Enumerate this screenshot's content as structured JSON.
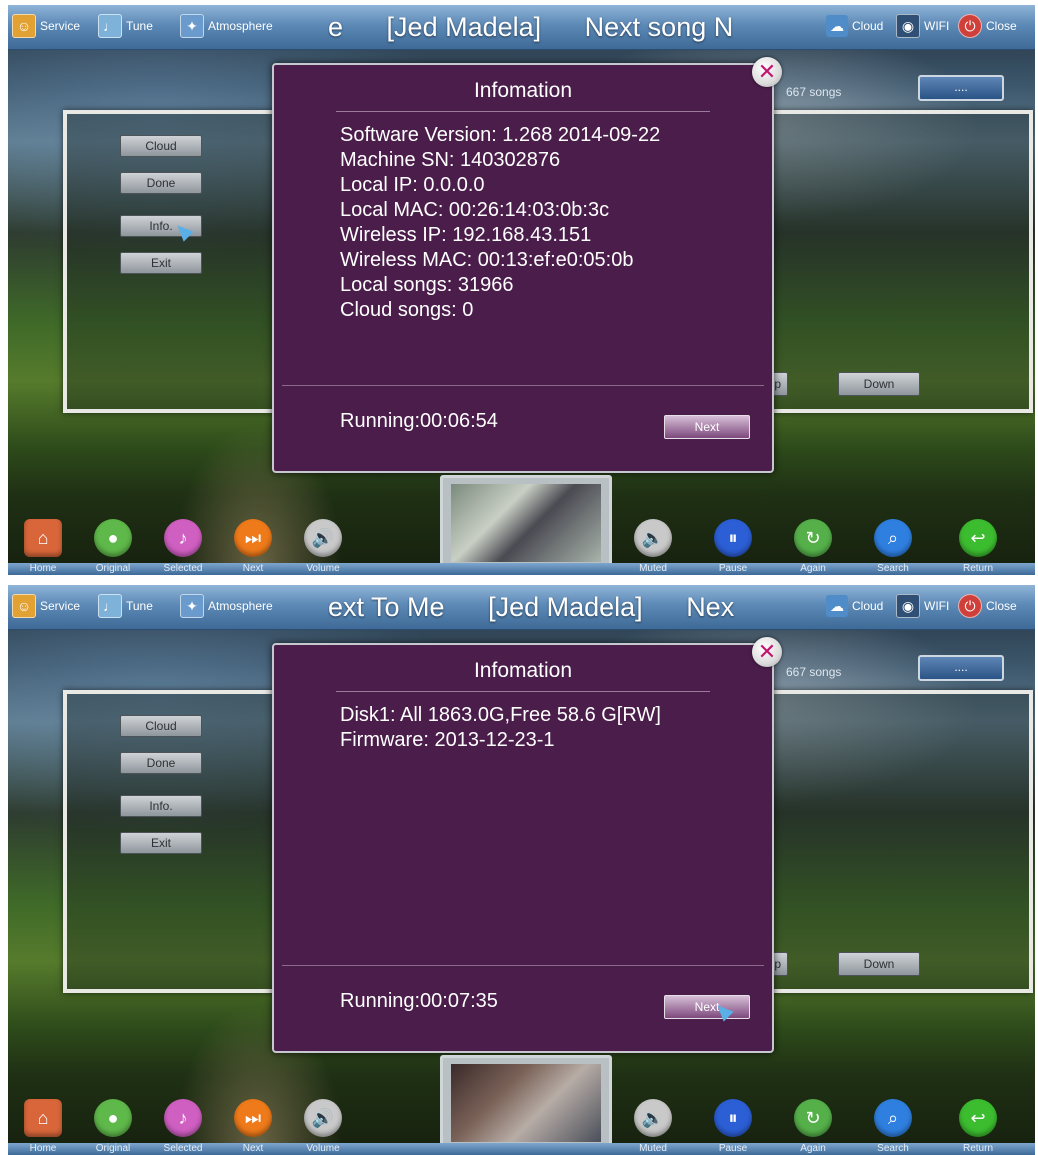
{
  "colors": {
    "dialog_bg": "#4a1d4a",
    "close_accent": "#c0166e",
    "topbar": "#5c89b6"
  },
  "topbar": {
    "left_items": [
      {
        "label": "Service",
        "icon": "service-icon"
      },
      {
        "label": "Tune",
        "icon": "tune-icon"
      },
      {
        "label": "Atmosphere",
        "icon": "atmosphere-icon"
      }
    ],
    "right_items": [
      {
        "label": "Cloud",
        "icon": "cloud-icon"
      },
      {
        "label": "WIFI",
        "icon": "wifi-icon"
      },
      {
        "label": "Close",
        "icon": "power-icon"
      }
    ]
  },
  "left_menu": [
    "Cloud",
    "Done",
    "Info.",
    "Exit"
  ],
  "list_nav": {
    "up": "p",
    "down": "Down"
  },
  "song_count": "667 songs",
  "more_button": "....",
  "bottom_bar": [
    {
      "label": "Home",
      "icon": "home-icon"
    },
    {
      "label": "Original",
      "icon": "original-icon"
    },
    {
      "label": "Selected",
      "icon": "selected-icon"
    },
    {
      "label": "Next",
      "icon": "next-icon"
    },
    {
      "label": "Volume",
      "icon": "volume-icon"
    },
    {
      "label": "Muted",
      "icon": "muted-icon"
    },
    {
      "label": "Pause",
      "icon": "pause-icon"
    },
    {
      "label": "Again",
      "icon": "again-icon"
    },
    {
      "label": "Search",
      "icon": "search-icon"
    },
    {
      "label": "Return",
      "icon": "return-icon"
    }
  ],
  "screens": [
    {
      "ticker": [
        "e",
        "[Jed Madela]",
        "Next song N"
      ],
      "dialog": {
        "title": "Infomation",
        "lines": [
          "Software Version: 1.268 2014-09-22",
          "Machine SN: 140302876",
          "Local IP: 0.0.0.0",
          "Local MAC: 00:26:14:03:0b:3c",
          "Wireless IP: 192.168.43.151",
          "Wireless MAC: 00:13:ef:e0:05:0b",
          "Local songs: 31966",
          "Cloud songs: 0"
        ],
        "running": "Running:00:06:54",
        "next_button": "Next"
      }
    },
    {
      "ticker": [
        "ext To Me",
        "[Jed Madela]",
        "Nex"
      ],
      "dialog": {
        "title": "Infomation",
        "lines": [
          "Disk1: All 1863.0G,Free 58.6 G[RW]",
          "Firmware: 2013-12-23-1"
        ],
        "running": "Running:00:07:35",
        "next_button": "Next"
      }
    }
  ]
}
